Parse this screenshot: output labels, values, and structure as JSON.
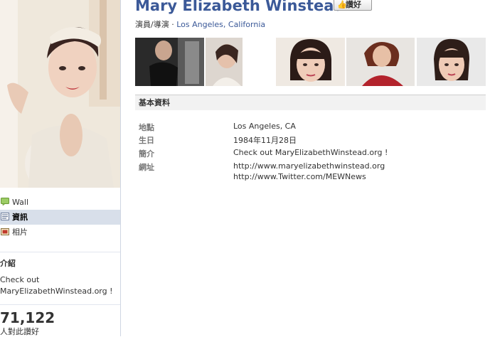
{
  "header": {
    "name": "Mary Elizabeth Winstead",
    "like_button": "讚好",
    "category": "演員/導演 · ",
    "location_link": "Los Angeles, California"
  },
  "nav": {
    "items": [
      {
        "label": "Wall",
        "icon": "wall-icon"
      },
      {
        "label": "資訊",
        "icon": "info-icon",
        "selected": true
      },
      {
        "label": "相片",
        "icon": "photos-icon"
      }
    ]
  },
  "intro": {
    "title": "介紹",
    "text": "Check out MaryElizabethWinstead.org !"
  },
  "likes": {
    "count": "71,122",
    "label": "人對此讚好"
  },
  "info": {
    "section_title": "基本資料",
    "rows": [
      {
        "label": "地點",
        "value": "Los Angeles, CA"
      },
      {
        "label": "生日",
        "value": "1984年11月28日"
      },
      {
        "label": "簡介",
        "value": "Check out MaryElizabethWinstead.org !"
      },
      {
        "label": "網址",
        "value": "http://www.maryelizabethwinstead.org",
        "value2": "http://www.Twitter.com/MEWNews"
      }
    ]
  },
  "colors": {
    "brand": "#3b5998",
    "selected_nav": "#d8dfea"
  }
}
